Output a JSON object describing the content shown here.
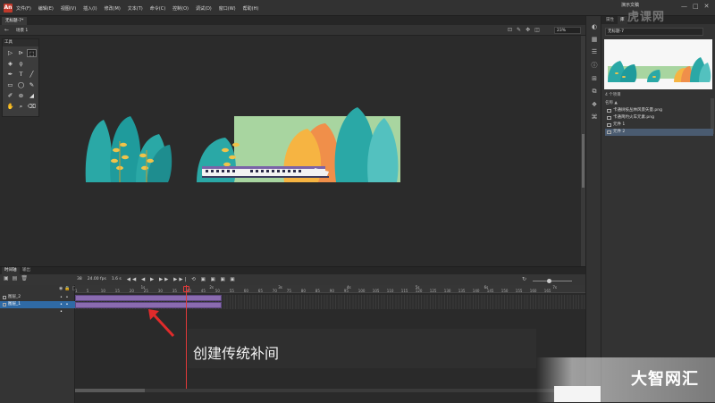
{
  "app": {
    "logo_text": "An",
    "window_title": "演示文稿",
    "menu": [
      "文件(F)",
      "编辑(E)",
      "视图(V)",
      "插入(I)",
      "修改(M)",
      "文本(T)",
      "命令(C)",
      "控制(O)",
      "调试(D)",
      "窗口(W)",
      "帮助(H)"
    ],
    "window_controls": [
      "—",
      "□",
      "✕"
    ]
  },
  "document": {
    "tab_label": "无标题-7*",
    "scene_label": "场景 1",
    "zoom": "23%"
  },
  "tools": {
    "title": "工具",
    "items": [
      {
        "icon": "▷",
        "name": "selection-tool-icon"
      },
      {
        "icon": "⊳",
        "name": "subselection-tool-icon"
      },
      {
        "icon": "⬚",
        "name": "free-transform-tool-icon",
        "selected": true
      },
      {
        "icon": "◈",
        "name": "3d-rotation-tool-icon"
      },
      {
        "icon": "ϙ",
        "name": "lasso-tool-icon"
      },
      {
        "icon": "",
        "name": "empty-slot"
      },
      {
        "icon": "✒",
        "name": "pen-tool-icon"
      },
      {
        "icon": "T",
        "name": "text-tool-icon"
      },
      {
        "icon": "╱",
        "name": "line-tool-icon"
      },
      {
        "icon": "▭",
        "name": "rectangle-tool-icon"
      },
      {
        "icon": "◯",
        "name": "oval-tool-icon"
      },
      {
        "icon": "✎",
        "name": "pencil-tool-icon"
      },
      {
        "icon": "✐",
        "name": "brush-tool-icon"
      },
      {
        "icon": "⊚",
        "name": "bone-tool-icon"
      },
      {
        "icon": "◢",
        "name": "paint-bucket-tool-icon"
      },
      {
        "icon": "✋",
        "name": "hand-tool-icon"
      },
      {
        "icon": "⌕",
        "name": "zoom-tool-icon"
      },
      {
        "icon": "⌫",
        "name": "eraser-tool-icon"
      }
    ]
  },
  "timeline": {
    "tab_timeline": "时间轴",
    "tab_output": "输出",
    "fps": "24.00 fps",
    "frame": "38",
    "seconds": "1.6 s",
    "layers": [
      {
        "name": "图层_2"
      },
      {
        "name": "图层_1"
      }
    ],
    "seconds_ticks": [
      "1s",
      "2s",
      "3s",
      "4s",
      "5s",
      "6s",
      "7s"
    ],
    "frame_ticks": [
      "1",
      "5",
      "10",
      "15",
      "20",
      "25",
      "30",
      "35",
      "40",
      "45",
      "50",
      "55",
      "60",
      "65",
      "70",
      "75",
      "80",
      "85",
      "90",
      "95",
      "100",
      "105",
      "110",
      "115",
      "120",
      "125",
      "130",
      "135",
      "140",
      "145",
      "150",
      "155",
      "160",
      "165"
    ]
  },
  "annotation": {
    "text": "创建传统补间"
  },
  "library": {
    "tab_props": "属性",
    "tab_lib": "库",
    "document_select": "无标题-7",
    "item_count": "4 个项目",
    "column_name": "名称 ▲",
    "items": [
      {
        "name": "卡通树枝丛林风景矢量.png",
        "type": "bitmap"
      },
      {
        "name": "卡通简约火车元素.png",
        "type": "bitmap"
      },
      {
        "name": "元件 1",
        "type": "symbol"
      },
      {
        "name": "元件 2",
        "type": "symbol",
        "selected": true
      }
    ]
  },
  "watermarks": {
    "top": "虎课网",
    "bottom": "大智网汇"
  },
  "colors": {
    "tween": "#8a6bb0",
    "playhead": "#e23a3a",
    "selected_layer": "#2f6aa5"
  }
}
